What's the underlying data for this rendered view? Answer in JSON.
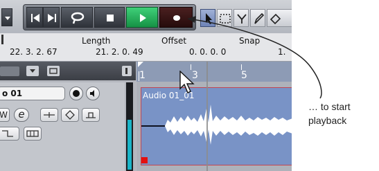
{
  "infoline": {
    "start_value": "22. 3. 2. 67",
    "length_label": "Length",
    "length_value": "21. 2. 0. 49",
    "offset_label": "Offset",
    "offset_value": "0. 0. 0. 0",
    "snap_label": "Snap",
    "snap_value": "1."
  },
  "track": {
    "name": "o 01",
    "e_button": "e"
  },
  "ruler": {
    "marks": [
      "1",
      "3",
      "5"
    ]
  },
  "event": {
    "label": "Audio 01_01"
  },
  "callout": {
    "line1": "… to start",
    "line2": "playback"
  },
  "colors": {
    "play_green": "#21b35a",
    "record_dark": "#3a1616",
    "event_blue": "#7993c6",
    "meter_cyan": "#19b4c7"
  },
  "icons": [
    "chevron-down-icon",
    "go-to-start-icon",
    "go-to-end-icon",
    "cycle-icon",
    "stop-icon",
    "play-icon",
    "record-icon",
    "pointer-tool-icon",
    "range-tool-icon",
    "split-tool-icon",
    "draw-tool-icon"
  ]
}
